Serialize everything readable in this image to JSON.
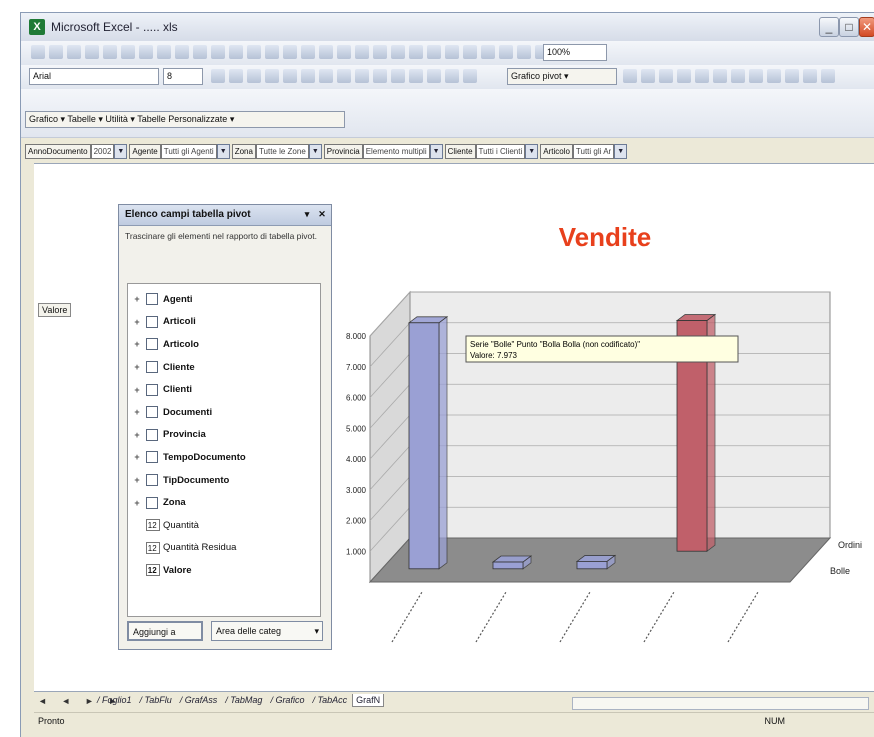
{
  "window": {
    "title": "Microsoft Excel - ..... xls",
    "app_icon_label": "X",
    "controls": {
      "minimize": "_",
      "maximize": "□",
      "close": "✕"
    }
  },
  "toolbar": {
    "zoom": "100%",
    "font_name": "Arial",
    "font_size": "8",
    "pivot_menu": "Grafico pivot ▾",
    "chart_menu": "Grafico ▾ Tabelle ▾ Utilità ▾ Tabelle Personalizzate ▾"
  },
  "page_fields": [
    {
      "label": "AnnoDocumento",
      "value": "2002"
    },
    {
      "label": "Agente",
      "value": "Tutti gli Agenti"
    },
    {
      "label": "Zona",
      "value": "Tutte le Zone"
    },
    {
      "label": "Provincia",
      "value": "Elemento multipli"
    },
    {
      "label": "Cliente",
      "value": "Tutti i Clienti"
    },
    {
      "label": "Articolo",
      "value": "Tutti gli Ar"
    }
  ],
  "row_field_button": "Valore",
  "field_panel": {
    "title": "Elenco campi tabella pivot",
    "description": "Trascinare gli elementi nel rapporto di tabella pivot.",
    "fields": [
      {
        "name": "Agenti",
        "kind": "dimension"
      },
      {
        "name": "Articoli",
        "kind": "dimension"
      },
      {
        "name": "Articolo",
        "kind": "dimension"
      },
      {
        "name": "Cliente",
        "kind": "dimension"
      },
      {
        "name": "Clienti",
        "kind": "dimension"
      },
      {
        "name": "Documenti",
        "kind": "dimension"
      },
      {
        "name": "Provincia",
        "kind": "dimension"
      },
      {
        "name": "TempoDocumento",
        "kind": "dimension"
      },
      {
        "name": "TipDocumento",
        "kind": "dimension"
      },
      {
        "name": "Zona",
        "kind": "dimension"
      },
      {
        "name": "Quantità",
        "kind": "measure"
      },
      {
        "name": "Quantità Residua",
        "kind": "measure"
      },
      {
        "name": "Valore",
        "kind": "measure"
      }
    ],
    "measure_glyph": "12 ",
    "add_button": "Aggiungi a",
    "area_select": "Area delle categ"
  },
  "chart_data": {
    "type": "bar",
    "title": "Vendite",
    "ylim": [
      0,
      8000
    ],
    "yticks": [
      "8.000",
      "7.000",
      "6.000",
      "5.000",
      "4.000",
      "3.000",
      "2.000",
      "1.000"
    ],
    "categories": [
      "",
      "",
      "",
      "",
      ""
    ],
    "series": [
      {
        "name": "Ordini",
        "values": [
          0,
          0,
          0,
          7500,
          0
        ],
        "color": "#c0606a"
      },
      {
        "name": "Bolle",
        "values": [
          8000,
          220,
          240,
          0,
          0
        ],
        "color": "#9aa0d4"
      }
    ],
    "tooltip": {
      "line1": "Serie \"Bolle\" Punto \"Bolla Bolla (non codificato)\"",
      "line2": "Valore: 7.973"
    }
  },
  "sheet_tabs": {
    "nav": "◄ ◄ ► ►",
    "tabs": [
      "Foglio1",
      "TabFlu",
      "GrafAss",
      "TabMag",
      "Grafico",
      "TabAcc",
      "GrafN"
    ],
    "active_index": 6
  },
  "status": {
    "left": "Pronto",
    "right": "NUM"
  }
}
